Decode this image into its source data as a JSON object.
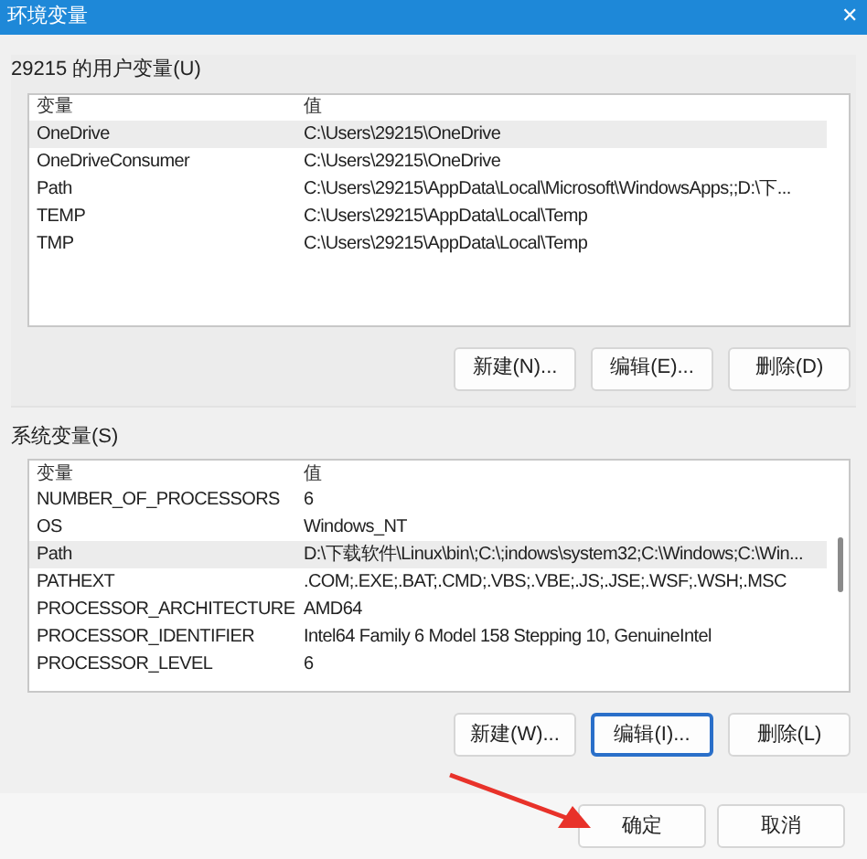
{
  "window": {
    "title": "环境变量",
    "close": "✕"
  },
  "user_variables": {
    "label": "29215 的用户变量(U)",
    "columns": [
      "变量",
      "值"
    ],
    "rows": [
      {
        "name": "OneDrive",
        "value": "C:\\Users\\29215\\OneDrive",
        "selected": true
      },
      {
        "name": "OneDriveConsumer",
        "value": "C:\\Users\\29215\\OneDrive",
        "selected": false
      },
      {
        "name": "Path",
        "value": "C:\\Users\\29215\\AppData\\Local\\Microsoft\\WindowsApps;;D:\\下...",
        "selected": false
      },
      {
        "name": "TEMP",
        "value": "C:\\Users\\29215\\AppData\\Local\\Temp",
        "selected": false
      },
      {
        "name": "TMP",
        "value": "C:\\Users\\29215\\AppData\\Local\\Temp",
        "selected": false
      }
    ],
    "buttons": [
      {
        "label": "新建(N)...",
        "focused": false
      },
      {
        "label": "编辑(E)...",
        "focused": false
      },
      {
        "label": "删除(D)",
        "focused": false
      }
    ]
  },
  "system_variables": {
    "label": "系统变量(S)",
    "columns": [
      "变量",
      "值"
    ],
    "rows": [
      {
        "name": "NUMBER_OF_PROCESSORS",
        "value": "6",
        "selected": false
      },
      {
        "name": "OS",
        "value": "Windows_NT",
        "selected": false
      },
      {
        "name": "Path",
        "value": "D:\\下载软件\\Linux\\bin\\;C:\\;indows\\system32;C:\\Windows;C:\\Win...",
        "selected": true
      },
      {
        "name": "PATHEXT",
        "value": ".COM;.EXE;.BAT;.CMD;.VBS;.VBE;.JS;.JSE;.WSF;.WSH;.MSC",
        "selected": false
      },
      {
        "name": "PROCESSOR_ARCHITECTURE",
        "value": "AMD64",
        "selected": false
      },
      {
        "name": "PROCESSOR_IDENTIFIER",
        "value": "Intel64 Family 6 Model 158 Stepping 10, GenuineIntel",
        "selected": false
      },
      {
        "name": "PROCESSOR_LEVEL",
        "value": "6",
        "selected": false
      }
    ],
    "buttons": [
      {
        "label": "新建(W)...",
        "focused": false
      },
      {
        "label": "编辑(I)...",
        "focused": true
      },
      {
        "label": "删除(L)",
        "focused": false
      }
    ]
  },
  "dialog_buttons": [
    {
      "label": "确定",
      "focused": false
    },
    {
      "label": "取消",
      "focused": false
    }
  ]
}
